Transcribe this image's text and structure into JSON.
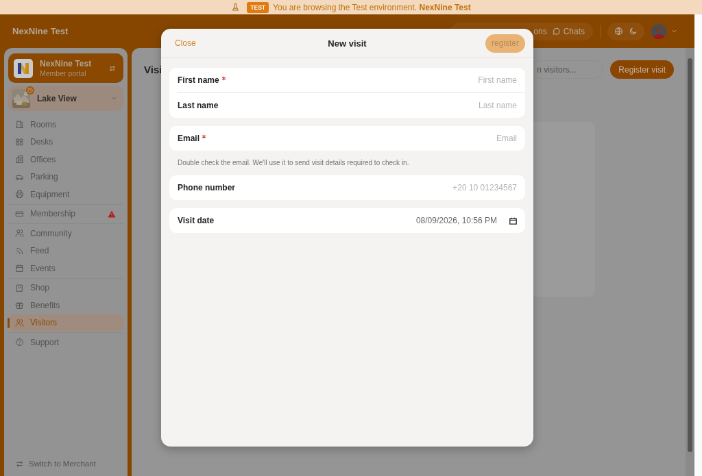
{
  "banner": {
    "badge": "TEST",
    "text": "You are browsing the Test environment. **NexNine Test**"
  },
  "header": {
    "brand": "NexNine Test",
    "notifications_label": "ons",
    "chats_label": "Chats"
  },
  "sidebar": {
    "org": {
      "name": "NexNine Test",
      "subtitle": "Member portal"
    },
    "location": {
      "name": "Lake View"
    },
    "groups": [
      [
        {
          "label": "Rooms",
          "selected": false,
          "alert": false
        },
        {
          "label": "Desks",
          "selected": false,
          "alert": false
        },
        {
          "label": "Offices",
          "selected": false,
          "alert": false
        },
        {
          "label": "Parking",
          "selected": false,
          "alert": false
        },
        {
          "label": "Equipment",
          "selected": false,
          "alert": false
        }
      ],
      [
        {
          "label": "Membership",
          "selected": false,
          "alert": true
        }
      ],
      [
        {
          "label": "Community",
          "selected": false,
          "alert": false
        },
        {
          "label": "Feed",
          "selected": false,
          "alert": false
        },
        {
          "label": "Events",
          "selected": false,
          "alert": false
        }
      ],
      [
        {
          "label": "Shop",
          "selected": false,
          "alert": false
        },
        {
          "label": "Benefits",
          "selected": false,
          "alert": false
        },
        {
          "label": "Visitors",
          "selected": true,
          "alert": false
        }
      ],
      [
        {
          "label": "Support",
          "selected": false,
          "alert": false
        }
      ]
    ],
    "footer": "Switch to Merchant"
  },
  "main": {
    "title": "Visi",
    "search": {
      "placeholder": "n visitors..."
    },
    "register_button": "Register visit"
  },
  "modal": {
    "close": "Close",
    "title": "New visit",
    "submit": {
      "label": "register",
      "disabled": true
    },
    "sections": [
      {
        "kind": "group",
        "fields": [
          {
            "kind": "text",
            "label": "First name",
            "required": true,
            "placeholder": "First name"
          },
          {
            "kind": "text",
            "label": "Last name",
            "required": false,
            "placeholder": "Last name"
          }
        ]
      },
      {
        "kind": "group",
        "fields": [
          {
            "kind": "text",
            "label": "Email",
            "required": true,
            "placeholder": "Email"
          }
        ]
      },
      {
        "kind": "hint",
        "text": "Double check the email. We'll use it to send visit details required to check in."
      },
      {
        "kind": "group",
        "fields": [
          {
            "kind": "text",
            "label": "Phone number",
            "required": false,
            "placeholder": "+20 10 01234567"
          }
        ]
      },
      {
        "kind": "group",
        "fields": [
          {
            "kind": "datetime",
            "label": "Visit date",
            "required": false,
            "value": "08/09/2026, 10:56 PM"
          }
        ]
      }
    ]
  }
}
